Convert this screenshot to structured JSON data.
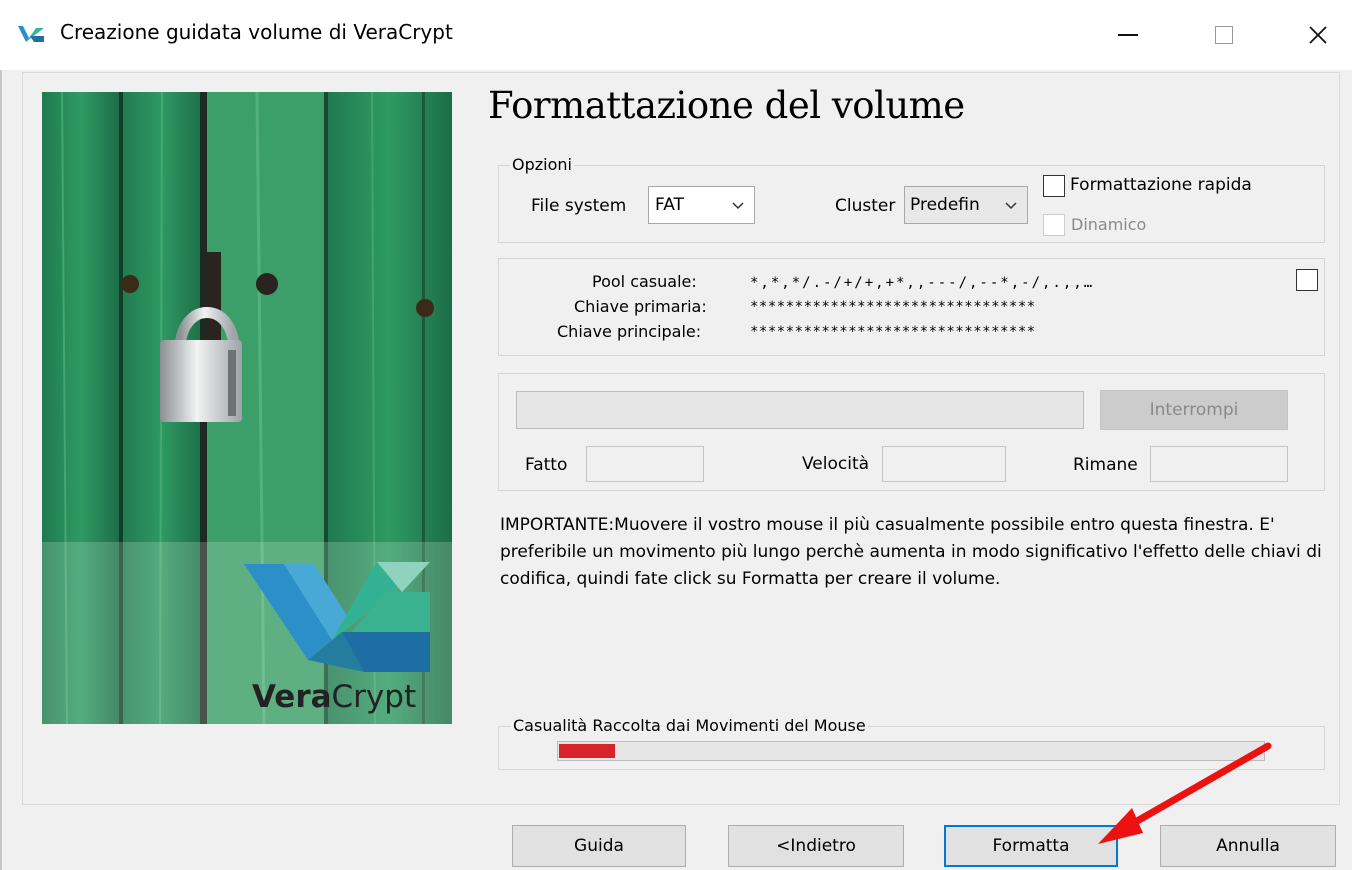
{
  "window": {
    "title": "Creazione guidata volume di VeraCrypt",
    "icon": "veracrypt-logo-icon"
  },
  "image_panel": {
    "brand_bold": "Vera",
    "brand_light": "Crypt"
  },
  "page_title": "Formattazione del volume",
  "options": {
    "legend": "Opzioni",
    "filesystem_label": "File system",
    "filesystem_value": "FAT",
    "cluster_label": "Cluster",
    "cluster_value": "Predefin",
    "quick_format_label": "Formattazione rapida",
    "quick_format_checked": false,
    "dynamic_label": "Dinamico",
    "dynamic_enabled": false
  },
  "keys": {
    "pool_label": "Pool casuale:",
    "pool_value": "*,*,*/.-/+/+,+*,,---/,--*,-/,.,,…",
    "primary_key_label": "Chiave primaria:",
    "primary_key_value": "********************************",
    "master_key_label": "Chiave principale:",
    "master_key_value": "********************************",
    "show_checked": false
  },
  "progress": {
    "abort_label": "Interrompi",
    "done_label": "Fatto",
    "speed_label": "Velocità",
    "remaining_label": "Rimane"
  },
  "important_text": "IMPORTANTE:Muovere il vostro mouse il più casualmente possibile entro questa finestra. E' preferibile un movimento più lungo perchè aumenta in modo significativo l'effetto delle chiavi di codifica, quindi fate click su Formatta per creare il volume.",
  "entropy": {
    "legend": "Casualità Raccolta dai Movimenti del Mouse",
    "fill_fraction": 0.08,
    "fill_color": "#d9232a"
  },
  "buttons": {
    "help": "Guida",
    "back": "<Indietro",
    "format": "Formatta",
    "cancel": "Annulla"
  },
  "annotation": {
    "arrow_color": "#ee1111",
    "points_to": "format-button"
  }
}
